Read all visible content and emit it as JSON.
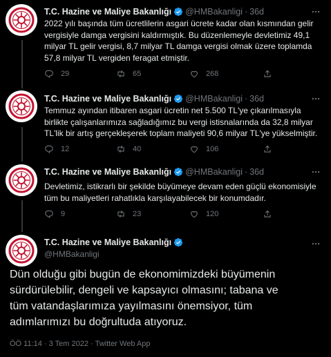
{
  "colors": {
    "background": "#000000",
    "text": "#e7e9ea",
    "muted": "#71767b",
    "verified": "#1d9bf0",
    "logo": "#c4122f"
  },
  "account": {
    "name": "T.C. Hazine ve Maliye Bakanlığı",
    "handle": "@HMBakanligi",
    "verified_icon": "verified-badge-icon",
    "avatar_icon": "ministry-logo"
  },
  "tweets": [
    {
      "name": "T.C. Hazine ve Maliye Bakanlığı",
      "handle": "@HMBakanligi",
      "dot": "·",
      "time": "36d",
      "text": "2022 yılı başında tüm ücretlilerin asgari ücrete kadar olan kısmından gelir\nvergisiyle damga vergisini kaldırmıştık. Bu düzenlemeyle devletimiz 49,1\nmilyar TL gelir vergisi, 8,7 milyar TL damga vergisi olmak üzere toplamda\n57,8 milyar TL vergiden feragat etmiştir.",
      "replies": "29",
      "retweets": "65",
      "likes": "268"
    },
    {
      "name": "T.C. Hazine ve Maliye Bakanlığı",
      "handle": "@HMBakanligi",
      "dot": "·",
      "time": "36d",
      "text": "Temmuz ayından itibaren asgari ücretin net 5.500 TL'ye çıkarılmasıyla\nbirlikte çalışanlarımıza sağladığımız bu vergi istisnalarında da 32,8 milyar\nTL'lik bir artış gerçekleşerek toplam maliyeti 90,6 milyar TL'ye yükselmiştir.",
      "replies": "12",
      "retweets": "40",
      "likes": "106"
    },
    {
      "name": "T.C. Hazine ve Maliye Bakanlığı",
      "handle": "@HMBakanligi",
      "dot": "·",
      "time": "36d",
      "text": "Devletimiz, istikrarlı bir şekilde büyümeye devam eden güçlü ekonomisiyle\ntüm bu maliyetleri rahatlıkla karşılayabilecek bir konumdadır.",
      "replies": "9",
      "retweets": "23",
      "likes": "120"
    }
  ],
  "main_tweet": {
    "name": "T.C. Hazine ve Maliye Bakanlığı",
    "handle": "@HMBakanligi",
    "text": "Dün olduğu gibi bugün de ekonomimizdeki büyümenin\nsürdürülebilir, dengeli ve kapsayıcı olmasını; tabana ve\ntüm vatandaşlarımıza yayılmasını önemsiyor, tüm\nadımlarımızı bu doğrultuda atıyoruz.",
    "time": "ÖÖ 11:14",
    "dot1": "·",
    "date": "3 Tem 2022",
    "dot2": "·",
    "source": "Twitter Web App"
  }
}
